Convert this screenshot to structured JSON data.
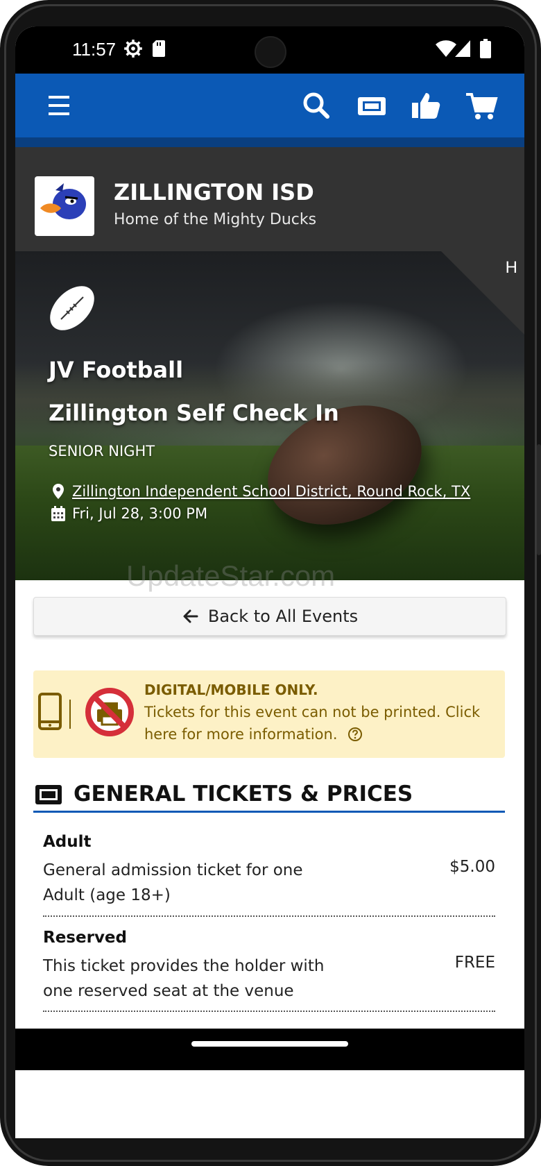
{
  "status_bar": {
    "time": "11:57"
  },
  "app_bar": {
    "icons": [
      "menu-icon",
      "search-icon",
      "ticket-icon",
      "thumbs-up-icon",
      "cart-icon"
    ],
    "color": "#0b59b5"
  },
  "org": {
    "name": "ZILLINGTON ISD",
    "tagline": "Home of the Mighty Ducks"
  },
  "hero": {
    "corner_letter": "H",
    "sport": "JV Football",
    "event_name": "Zillington Self Check In",
    "subtitle": "SENIOR NIGHT",
    "location": "Zillington Independent School District, Round Rock, TX",
    "date": "Fri, Jul 28, 3:00 PM"
  },
  "watermark": "UpdateStar.com",
  "back_button": {
    "label": "Back to All Events"
  },
  "notice": {
    "title": "DIGITAL/MOBILE ONLY.",
    "line1": "Tickets for this event can not be printed. Click",
    "line2": "here for more information.",
    "color": "#7a5c00",
    "background": "#fdf1c6"
  },
  "tickets": {
    "heading": "GENERAL TICKETS & PRICES",
    "items": [
      {
        "name": "Adult",
        "desc_line1": "General admission ticket for one",
        "desc_line2": "Adult (age 18+)",
        "price": "$5.00"
      },
      {
        "name": "Reserved",
        "desc_line1": "This ticket provides the holder with",
        "desc_line2": "one reserved seat at the venue",
        "price": "FREE"
      }
    ]
  }
}
